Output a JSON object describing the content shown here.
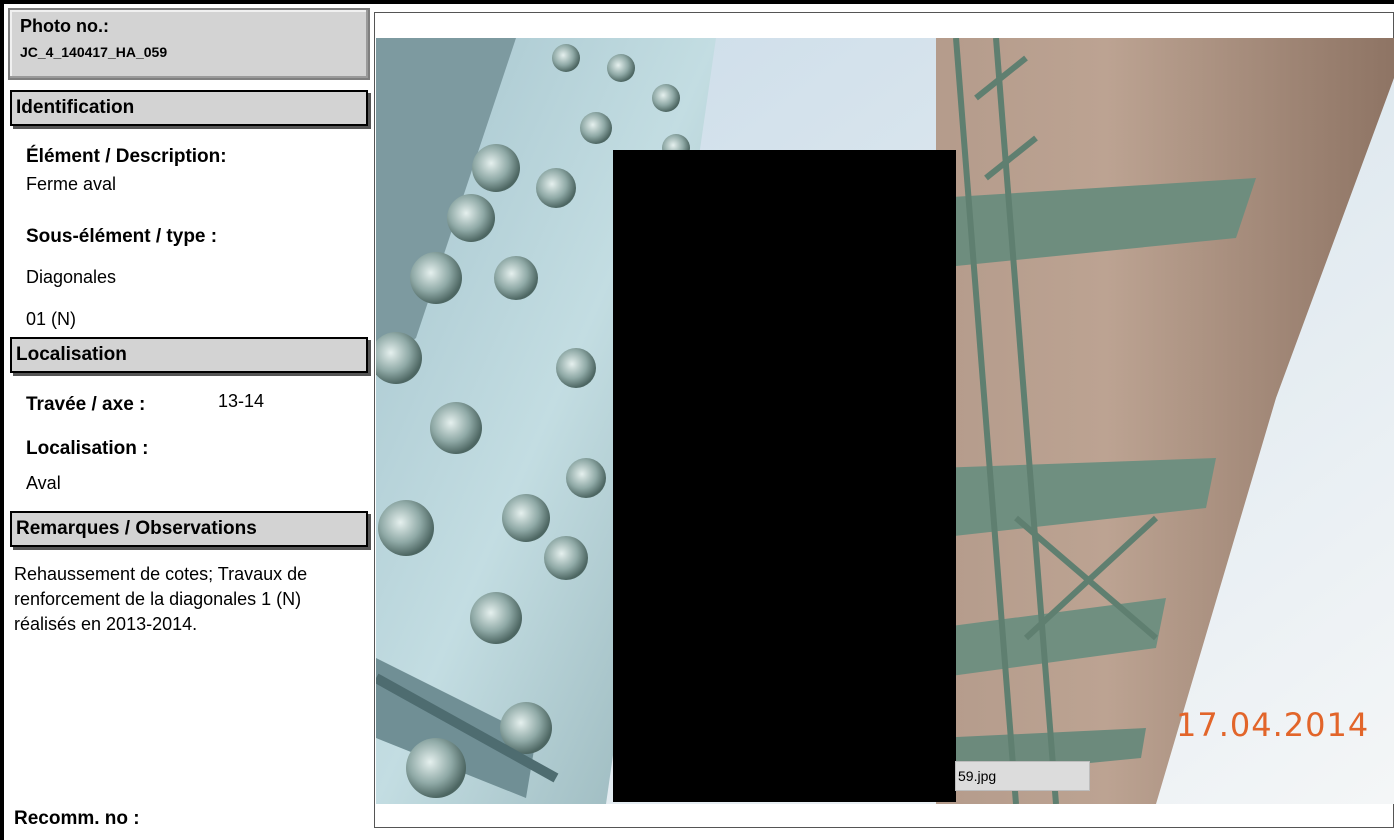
{
  "photo": {
    "label": "Photo no.:",
    "number": "JC_4_140417_HA_059"
  },
  "identification": {
    "header": "Identification",
    "element_label": "Élément / Description:",
    "element_value": "Ferme aval",
    "sub_element_label": "Sous-élément / type :",
    "sub_element_value": "Diagonales",
    "sub_element_code": "01 (N)"
  },
  "localisation": {
    "header": "Localisation",
    "span_label": "Travée / axe :",
    "span_value": "13-14",
    "location_label": "Localisation :",
    "location_value": "Aval"
  },
  "remarks": {
    "header": "Remarques / Observations",
    "lines": [
      "Rehaussement de cotes; Travaux de",
      "renforcement de la diagonales 1 (N)",
      "réalisés en 2013-2014."
    ]
  },
  "recommendation": {
    "label": "Recomm. no :"
  },
  "image": {
    "filename_fragment": "59.jpg",
    "date_stamp": "17.04.2014",
    "date_color": "#e2652a"
  }
}
